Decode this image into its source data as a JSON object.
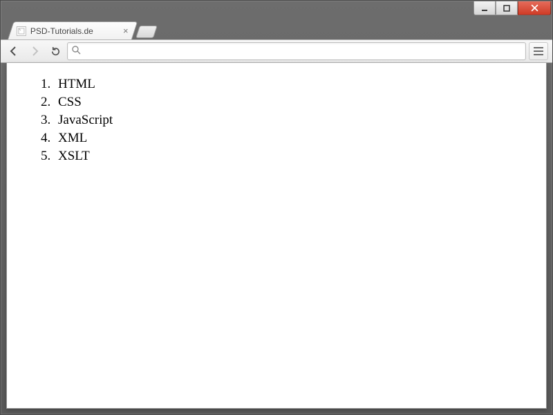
{
  "window": {
    "tab_title": "PSD-Tutorials.de",
    "address_value": ""
  },
  "page": {
    "list_items": [
      "HTML",
      "CSS",
      "JavaScript",
      "XML",
      "XSLT"
    ]
  }
}
